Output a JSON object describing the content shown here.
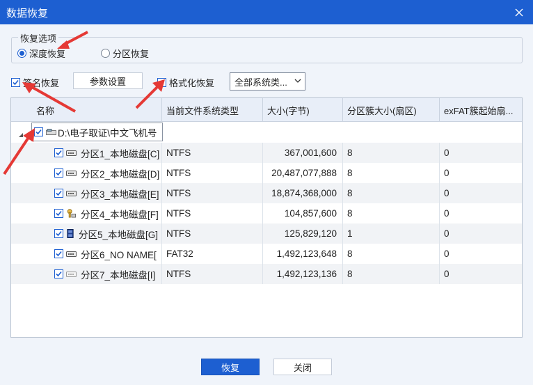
{
  "window": {
    "title": "数据恢复"
  },
  "options": {
    "group_label": "恢复选项",
    "deep_recovery": "深度恢复",
    "partition_recovery": "分区恢复",
    "signature_recovery": "签名恢复",
    "params_button": "参数设置",
    "format_recovery": "格式化恢复",
    "fs_combo_value": "全部系统类..."
  },
  "grid": {
    "columns": [
      "名称",
      "当前文件系统类型",
      "大小(字节)",
      "分区簇大小(扇区)",
      "exFAT簇起始扇..."
    ],
    "root": {
      "label": "D:\\电子取证\\中文飞机号"
    },
    "rows": [
      {
        "name": "分区1_本地磁盘[C]",
        "fs": "NTFS",
        "size": "367,001,600",
        "cluster": "8",
        "exfat": "0",
        "icon": "drive-icon"
      },
      {
        "name": "分区2_本地磁盘[D]",
        "fs": "NTFS",
        "size": "20,487,077,888",
        "cluster": "8",
        "exfat": "0",
        "icon": "drive-icon"
      },
      {
        "name": "分区3_本地磁盘[E]",
        "fs": "NTFS",
        "size": "18,874,368,000",
        "cluster": "8",
        "exfat": "0",
        "icon": "drive-icon"
      },
      {
        "name": "分区4_本地磁盘[F]",
        "fs": "NTFS",
        "size": "104,857,600",
        "cluster": "8",
        "exfat": "0",
        "icon": "key-drive-icon"
      },
      {
        "name": "分区5_本地磁盘[G]",
        "fs": "NTFS",
        "size": "125,829,120",
        "cluster": "1",
        "exfat": "0",
        "icon": "chip-drive-icon"
      },
      {
        "name": "分区6_NO NAME[",
        "fs": "FAT32",
        "size": "1,492,123,648",
        "cluster": "8",
        "exfat": "0",
        "icon": "drive-icon"
      },
      {
        "name": "分区7_本地磁盘[I]",
        "fs": "NTFS",
        "size": "1,492,123,136",
        "cluster": "8",
        "exfat": "0",
        "icon": "drive-light-icon"
      }
    ]
  },
  "footer": {
    "recover_button": "恢复",
    "close_button": "关闭"
  },
  "colors": {
    "titlebar": "#1d5fd1",
    "accent": "#1d5fd1",
    "annotation_arrow": "#e53935"
  }
}
